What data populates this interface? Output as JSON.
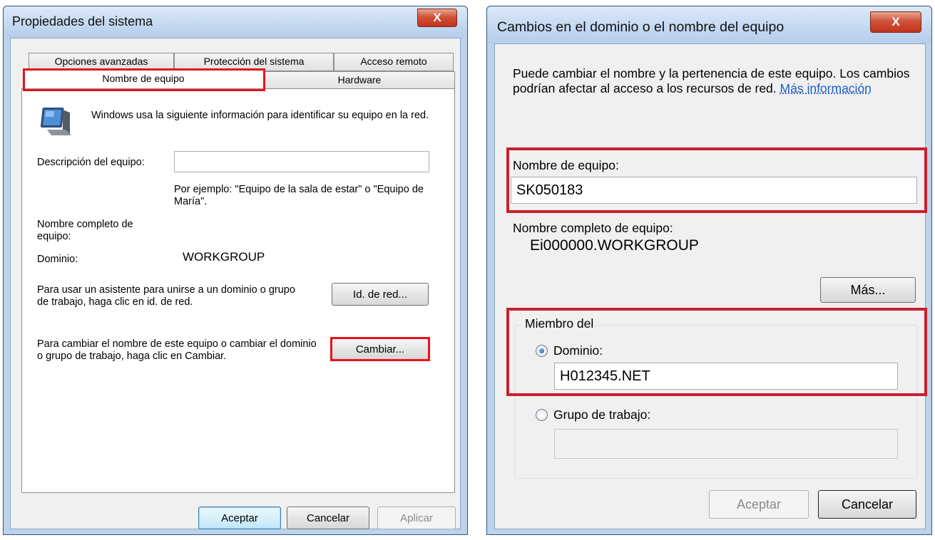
{
  "left_window": {
    "title": "Propiedades del sistema",
    "close_label": "X",
    "tabs_top": [
      "Opciones avanzadas",
      "Protección del sistema",
      "Acceso remoto"
    ],
    "tabs_bottom": [
      "Nombre de equipo",
      "Hardware"
    ],
    "active_tab": "Nombre de equipo",
    "intro": "Windows usa la siguiente información para identificar su equipo en la red.",
    "description_label": "Descripción del equipo:",
    "description_value": "",
    "example_text": "Por ejemplo: \"Equipo de la sala de estar\" o \"Equipo de María\".",
    "full_name_label": "Nombre completo de equipo:",
    "domain_label": "Dominio:",
    "domain_value": "WORKGROUP",
    "network_id_text": "Para usar un asistente para unirse a un dominio o grupo de trabajo, haga clic en id. de red.",
    "network_id_button": "Id. de red...",
    "change_text": "Para cambiar el nombre de este equipo o cambiar el dominio o grupo de trabajo, haga clic en Cambiar.",
    "change_button": "Cambiar...",
    "ok_button": "Aceptar",
    "cancel_button": "Cancelar",
    "apply_button": "Aplicar"
  },
  "right_window": {
    "title": "Cambios en el dominio o el nombre del equipo",
    "close_label": "X",
    "intro": "Puede cambiar el nombre y la pertenencia de este equipo. Los cambios podrían afectar al acceso a los recursos de red.",
    "more_info_link": "Más información",
    "computer_name_label": "Nombre de equipo:",
    "computer_name_value": "SK050183",
    "full_name_label": "Nombre completo de equipo:",
    "full_name_value": "Ei000000.WORKGROUP",
    "more_button": "Más...",
    "member_of_label": "Miembro del",
    "domain_radio_label": "Dominio:",
    "domain_value": "H012345.NET",
    "domain_selected": true,
    "workgroup_radio_label": "Grupo de trabajo:",
    "workgroup_value": "",
    "ok_button": "Aceptar",
    "cancel_button": "Cancelar"
  },
  "colors": {
    "highlight": "#e8131b",
    "title_bar": "#c5d9f1",
    "link": "#1f5ec4"
  }
}
